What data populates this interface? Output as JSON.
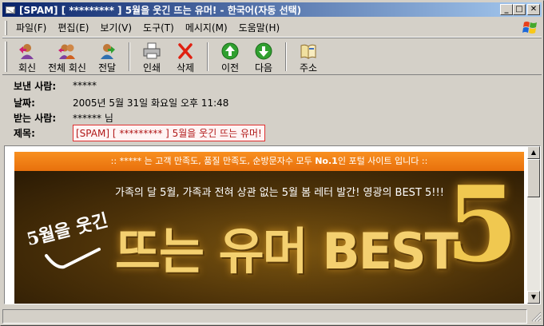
{
  "window": {
    "title": "[SPAM] [ ********* ] 5월을 웃긴 뜨는 유머! - 한국어(자동 선택)",
    "minimize": "_",
    "maximize": "□",
    "close": "✕"
  },
  "menu": [
    "파일(F)",
    "편집(E)",
    "보기(V)",
    "도구(T)",
    "메시지(M)",
    "도움말(H)"
  ],
  "toolbar": {
    "reply": "회신",
    "reply_all": "전체 회신",
    "forward": "전달",
    "print": "인쇄",
    "delete": "삭제",
    "previous": "이전",
    "next": "다음",
    "addresses": "주소"
  },
  "headers": {
    "from_label": "보낸 사람:",
    "from_value": "*****",
    "date_label": "날짜:",
    "date_value": "2005년 5월 31일 화요일 오후 11:48",
    "to_label": "받는 사람:",
    "to_value": "****** 님",
    "subject_label": "제목:",
    "subject_value": "[SPAM] [ ********* ] 5월을 웃긴 뜨는 유머!"
  },
  "message": {
    "banner_pre": ":: ***** 는 고객 만족도, 품질 만족도, 순방문자수 모두 ",
    "banner_bold": "No.1",
    "banner_post": "인 포털 사이트 입니다 ::",
    "handwritten": "5월을 웃긴",
    "tagline": "가족의 달 5월, 가족과 전혀 상관 없는 5월 봄 레터 발간! 영광의 BEST 5!!!",
    "big_title": "뜨는 유머 BEST",
    "big_five": "5"
  },
  "colors": {
    "title_start": "#0a246a",
    "title_end": "#a6caf0",
    "banner_orange": "#f08018",
    "subject_border": "#e03030",
    "gold": "#f4d070"
  },
  "icons": {
    "reply": "reply-icon",
    "reply_all": "reply-all-icon",
    "forward": "forward-icon",
    "print": "printer-icon",
    "delete": "delete-x-icon",
    "previous": "up-arrow-icon",
    "next": "down-arrow-icon",
    "addresses": "address-book-icon"
  }
}
